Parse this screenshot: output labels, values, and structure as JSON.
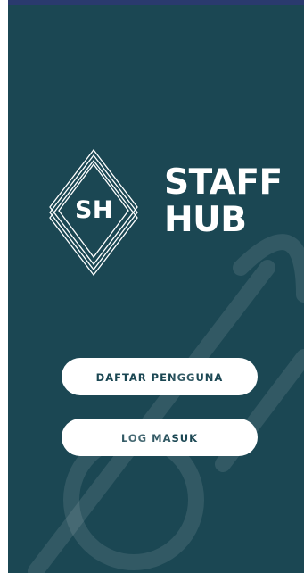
{
  "app": {
    "logo_initials": "SH",
    "logo_line1": "STAFF",
    "logo_line2": "HUB"
  },
  "actions": {
    "register_label": "DAFTAR PENGGUNA",
    "login_label": "LOG MASUK"
  },
  "colors": {
    "background": "#1b4753",
    "button_bg": "#ffffff",
    "button_text": "#1b4753"
  }
}
